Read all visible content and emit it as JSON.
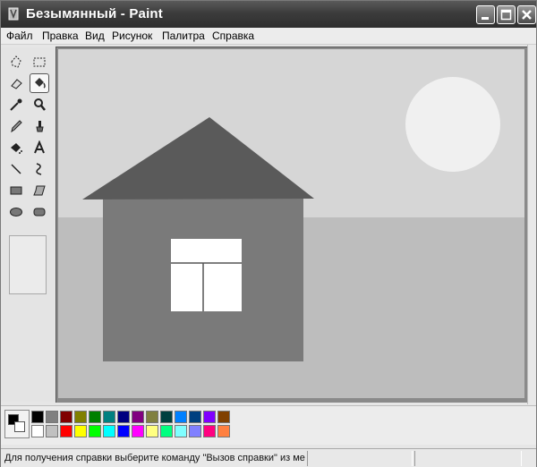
{
  "window": {
    "title": "Безымянный - Paint"
  },
  "menu": [
    "Файл",
    "Правка",
    "Вид",
    "Рисунок",
    "Палитра",
    "Справка"
  ],
  "tools": [
    "free-select-icon",
    "rect-select-icon",
    "eraser-icon",
    "fill-bucket-icon",
    "color-picker-icon",
    "magnifier-icon",
    "pencil-icon",
    "brush-icon",
    "airbrush-icon",
    "text-icon",
    "line-icon",
    "curve-icon",
    "rectangle-icon",
    "polygon-icon",
    "ellipse-icon",
    "rounded-rect-icon"
  ],
  "active_tool": "fill-bucket-icon",
  "canvas": {
    "sky_color": "#d6d6d6",
    "ground_color": "#bdbdbd",
    "sun_color": "#f0f0f0",
    "roof_color": "#5a5a5a",
    "house_color": "#7a7a7a",
    "window_color": "#ffffff"
  },
  "palette_colors_top": [
    "#000000",
    "#808080",
    "#800000",
    "#808000",
    "#008000",
    "#008080",
    "#000080",
    "#800080",
    "#808040",
    "#004040",
    "#0080ff",
    "#004080",
    "#8000ff",
    "#804000"
  ],
  "palette_colors_bottom": [
    "#ffffff",
    "#c0c0c0",
    "#ff0000",
    "#ffff00",
    "#00ff00",
    "#00ffff",
    "#0000ff",
    "#ff00ff",
    "#ffff80",
    "#00ff80",
    "#80ffff",
    "#8080ff",
    "#ff0080",
    "#ff8040"
  ],
  "status": {
    "help_text": "Для получения справки выберите команду \"Вызов справки\" из ме"
  }
}
